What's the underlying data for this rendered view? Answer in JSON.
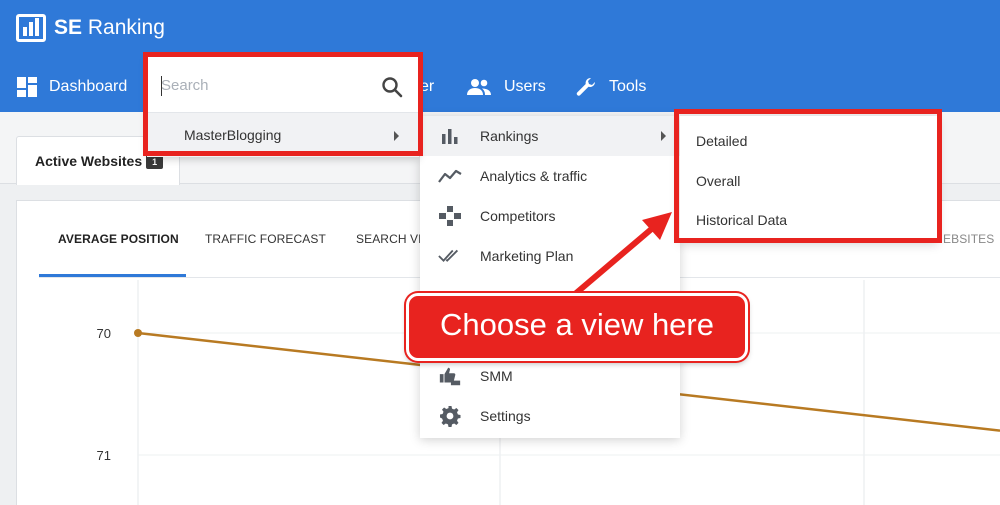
{
  "app": {
    "logo_bold": "SE",
    "logo_rest": " Ranking"
  },
  "nav": {
    "dashboard": "Dashboard",
    "partial_item": "er",
    "users": "Users",
    "tools": "Tools"
  },
  "tabs": {
    "active_websites": "Active Websites",
    "badge": "1"
  },
  "chart_tabs": [
    "AVERAGE POSITION",
    "TRAFFIC FORECAST",
    "SEARCH VIS",
    "EBSITES"
  ],
  "search": {
    "placeholder": "Search",
    "site": "MasterBlogging"
  },
  "site_menu": [
    {
      "label": "Rankings",
      "icon": "bar-chart-icon"
    },
    {
      "label": "Analytics & traffic",
      "icon": "trend-line-icon"
    },
    {
      "label": "Competitors",
      "icon": "puzzle-icon"
    },
    {
      "label": "Marketing Plan",
      "icon": "double-check-icon"
    },
    {
      "label": "SMM",
      "icon": "thumbs-icon"
    },
    {
      "label": "Settings",
      "icon": "gear-icon"
    }
  ],
  "submenu": {
    "detailed": "Detailed",
    "overall": "Overall",
    "historical": "Historical Data"
  },
  "annotation": {
    "callout": "Choose a view here"
  },
  "chart_data": {
    "type": "line",
    "y_axis_inverted": true,
    "y_ticks": [
      "70",
      "71"
    ],
    "series": [
      {
        "values": [
          70,
          70.8
        ]
      }
    ],
    "grid": true
  },
  "colors": {
    "header": "#2f79d8",
    "accent": "#2f79d8",
    "line": "#b87a22",
    "annotation": "#e8231f"
  }
}
